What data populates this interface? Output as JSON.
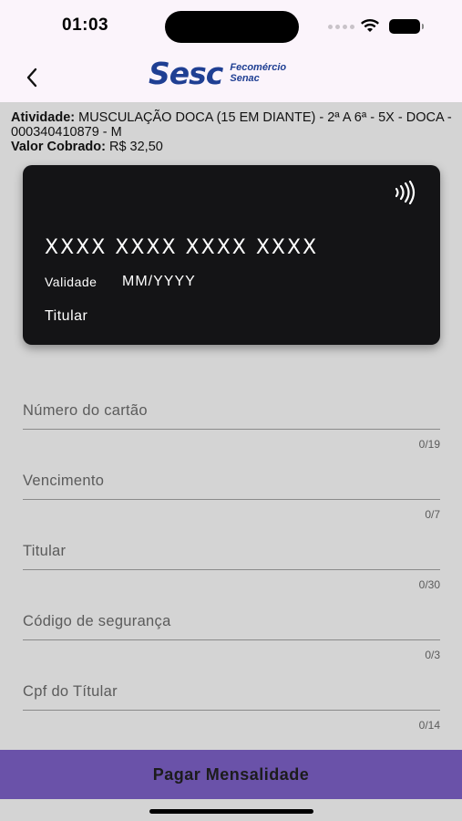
{
  "status_bar": {
    "time": "01:03"
  },
  "header": {
    "back_icon": "chevron-left-icon",
    "logo_main": "Sesc",
    "logo_sub_1": "Fecomércio",
    "logo_sub_2": "Senac"
  },
  "info": {
    "activity_label": "Atividade:",
    "activity_value": "MUSCULAÇÃO DOCA (15 EM DIANTE) - 2ª A 6ª - 5X - DOCA - 000340410879 - M",
    "price_label": "Valor Cobrado:",
    "price_value": "R$  32,50"
  },
  "card": {
    "number": "XXXX XXXX XXXX XXXX",
    "validity_label": "Validade",
    "validity_value": "MM/YYYY",
    "holder": "Titular",
    "contactless_icon": "contactless-icon"
  },
  "form": {
    "fields": [
      {
        "label": "Número do cartão",
        "counter": "0/19"
      },
      {
        "label": "Vencimento",
        "counter": "0/7"
      },
      {
        "label": "Titular",
        "counter": "0/30"
      },
      {
        "label": "Código de segurança",
        "counter": "0/3"
      },
      {
        "label": "Cpf do Títular",
        "counter": "0/14"
      }
    ]
  },
  "actions": {
    "pay_label": "Pagar Mensalidade"
  },
  "colors": {
    "accent": "#6a52a9",
    "brand": "#1f3f93",
    "card": "#141416",
    "background": "#d4d4d4"
  }
}
